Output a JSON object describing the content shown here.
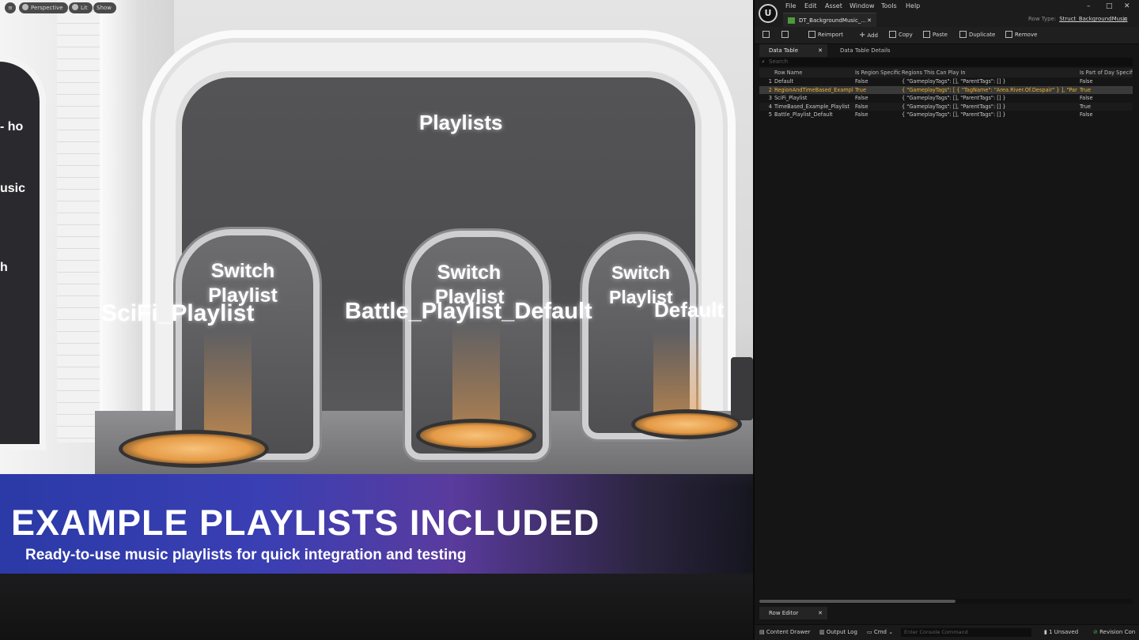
{
  "viewport": {
    "menu_icon": "hamburger-icon",
    "view_mode": "Perspective",
    "lighting": "Lit",
    "show": "Show"
  },
  "scene": {
    "left_screen_lines": [
      "- ho",
      "usic",
      "h"
    ],
    "title": "Playlists",
    "switch_label": "Switch Playlist",
    "playlists": [
      "SciFi_Playlist",
      "Battle_Playlist_Default",
      "Default"
    ]
  },
  "banner": {
    "title": "EXAMPLE PLAYLISTS INCLUDED",
    "subtitle": "Ready-to-use music playlists for quick integration and testing"
  },
  "editor": {
    "logo": "unreal-logo-icon",
    "menu": [
      "File",
      "Edit",
      "Asset",
      "Window",
      "Tools",
      "Help"
    ],
    "document_tab": "DT_BackgroundMusic_...",
    "row_type_label": "Row Type:",
    "row_type_value": "Struct_BackgroundMusic",
    "toolbar": {
      "reimport": "Reimport",
      "add": "Add",
      "copy": "Copy",
      "paste": "Paste",
      "duplicate": "Duplicate",
      "remove": "Remove"
    },
    "tabs": {
      "data_table": "Data Table",
      "details": "Data Table Details"
    },
    "search_placeholder": "Search",
    "table": {
      "columns": [
        "",
        "Row Name",
        "Is Region Specific",
        "Regions This Can Play In",
        "Is Part of Day Specific"
      ],
      "rows": [
        [
          "1",
          "Default",
          "False",
          "{ \"GameplayTags\": [], \"ParentTags\": [] }",
          "False"
        ],
        [
          "2",
          "RegionAndTimeBased_Example",
          "True",
          "{ \"GameplayTags\": [ { \"TagName\": \"Area.River.Of.Despair\" } ], \"ParentTags\"",
          "True"
        ],
        [
          "3",
          "SciFi_Playlist",
          "False",
          "{ \"GameplayTags\": [], \"ParentTags\": [] }",
          "False"
        ],
        [
          "4",
          "TimeBased_Example_Playlist",
          "False",
          "{ \"GameplayTags\": [], \"ParentTags\": [] }",
          "True"
        ],
        [
          "5",
          "Battle_Playlist_Default",
          "False",
          "{ \"GameplayTags\": [], \"ParentTags\": [] }",
          "False"
        ]
      ],
      "selected_row": 1
    },
    "row_editor_tab": "Row Editor",
    "status": {
      "content_drawer": "Content Drawer",
      "output_log": "Output Log",
      "cmd": "Cmd",
      "console_placeholder": "Enter Console Command",
      "unsaved": "1 Unsaved",
      "revision": "Revision Con"
    },
    "colors": {
      "selected_row_text": "#f0b42a",
      "panel_bg": "#151515"
    }
  }
}
